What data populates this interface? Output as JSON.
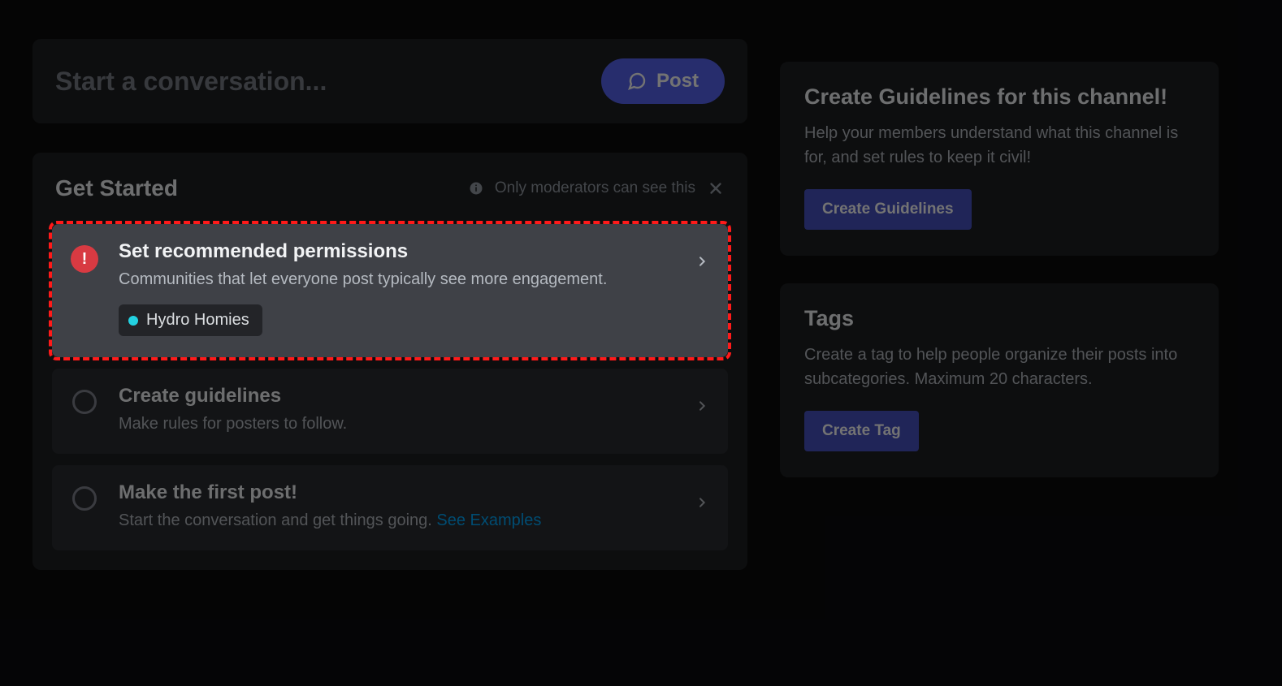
{
  "composer": {
    "placeholder": "Start a conversation...",
    "post_label": "Post"
  },
  "getStarted": {
    "title": "Get Started",
    "note": "Only moderators can see this",
    "steps": [
      {
        "title": "Set recommended permissions",
        "desc": "Communities that let everyone post typically see more engagement.",
        "tag": "Hydro Homies"
      },
      {
        "title": "Create guidelines",
        "desc": "Make rules for posters to follow."
      },
      {
        "title": "Make the first post!",
        "desc": "Start the conversation and get things going. ",
        "link": "See Examples"
      }
    ]
  },
  "sidebar": {
    "guidelines": {
      "title": "Create Guidelines for this channel!",
      "desc": "Help your members understand what this channel is for, and set rules to keep it civil!",
      "button": "Create Guidelines"
    },
    "tags": {
      "title": "Tags",
      "desc": "Create a tag to help people organize their posts into subcategories. Maximum 20 characters.",
      "button": "Create Tag"
    }
  }
}
